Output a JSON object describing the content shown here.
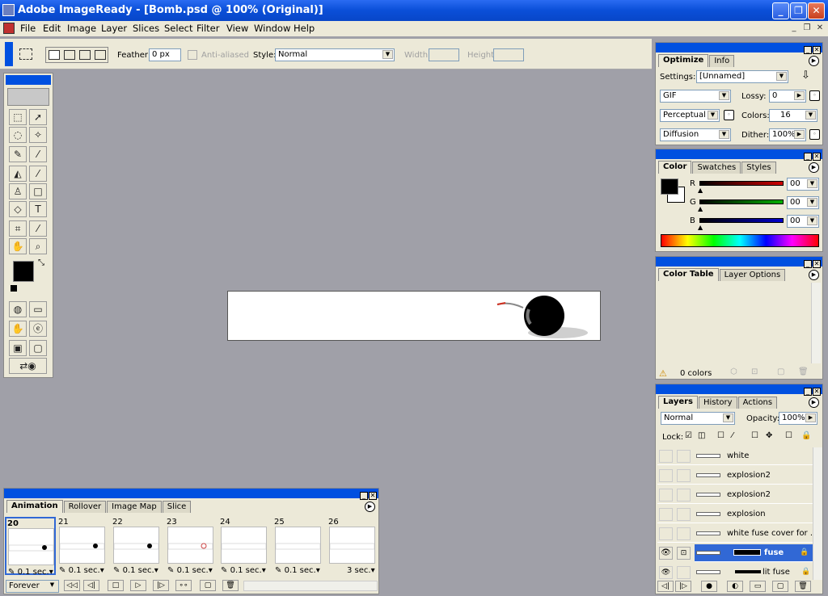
{
  "window": {
    "title": "Adobe ImageReady - [Bomb.psd @ 100% (Original)]"
  },
  "menu": [
    "File",
    "Edit",
    "Image",
    "Layer",
    "Slices",
    "Select",
    "Filter",
    "View",
    "Window",
    "Help"
  ],
  "options": {
    "feather_label": "Feather:",
    "feather_value": "0 px",
    "antialiased_label": "Anti-aliased",
    "style_label": "Style:",
    "style_value": "Normal",
    "width_label": "Width:",
    "height_label": "Height:"
  },
  "optimize": {
    "tabs": [
      "Optimize",
      "Info"
    ],
    "settings_label": "Settings:",
    "settings_value": "[Unnamed]",
    "format": "GIF",
    "lossy_label": "Lossy:",
    "lossy_value": "0",
    "palette": "Perceptual",
    "colors_label": "Colors:",
    "colors_value": "16",
    "dither_method": "Diffusion",
    "dither_label": "Dither:",
    "dither_value": "100%"
  },
  "color": {
    "tabs": [
      "Color",
      "Swatches",
      "Styles"
    ],
    "channels": [
      {
        "label": "R",
        "value": "00",
        "color": "#d00000"
      },
      {
        "label": "G",
        "value": "00",
        "color": "#00b000"
      },
      {
        "label": "B",
        "value": "00",
        "color": "#0000d0"
      }
    ]
  },
  "colortable": {
    "tabs": [
      "Color Table",
      "Layer Options"
    ],
    "count": "0 colors"
  },
  "layers": {
    "tabs": [
      "Layers",
      "History",
      "Actions"
    ],
    "blend": "Normal",
    "opacity_label": "Opacity:",
    "opacity_value": "100%",
    "lock_label": "Lock:",
    "items": [
      "white",
      "explosion2",
      "explosion2",
      "explosion",
      "white fuse cover for ...",
      "fuse",
      "lit fuse"
    ]
  },
  "animation": {
    "tabs": [
      "Animation",
      "Rollover",
      "Image Map",
      "Slice"
    ],
    "frames": [
      {
        "num": "20",
        "delay": "0.1 sec."
      },
      {
        "num": "21",
        "delay": "0.1 sec."
      },
      {
        "num": "22",
        "delay": "0.1 sec."
      },
      {
        "num": "23",
        "delay": "0.1 sec."
      },
      {
        "num": "24",
        "delay": "0.1 sec."
      },
      {
        "num": "25",
        "delay": "0.1 sec."
      },
      {
        "num": "26",
        "delay": "3 sec."
      }
    ],
    "loop": "Forever"
  },
  "accent": "#0050e0"
}
